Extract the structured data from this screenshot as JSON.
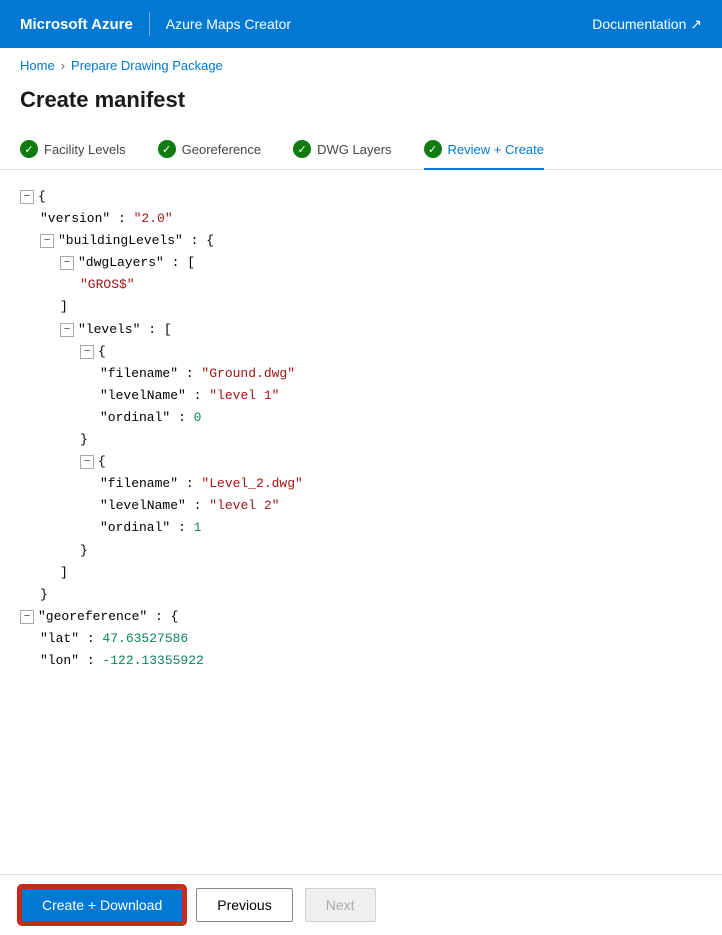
{
  "header": {
    "brand": "Microsoft Azure",
    "product": "Azure Maps Creator",
    "docs_label": "Documentation ↗"
  },
  "breadcrumb": {
    "home": "Home",
    "page": "Prepare Drawing Package"
  },
  "page_title": "Create manifest",
  "tabs": [
    {
      "id": "facility-levels",
      "label": "Facility Levels",
      "checked": true,
      "active": false
    },
    {
      "id": "georeference",
      "label": "Georeference",
      "checked": true,
      "active": false
    },
    {
      "id": "dwg-layers",
      "label": "DWG Layers",
      "checked": true,
      "active": false
    },
    {
      "id": "review-create",
      "label": "Review + Create",
      "checked": false,
      "active": true
    }
  ],
  "json": {
    "version_key": "\"version\"",
    "version_val": "\"2.0\"",
    "buildingLevels_key": "\"buildingLevels\"",
    "dwgLayers_key": "\"dwgLayers\"",
    "gros_val": "\"GROS$\"",
    "levels_key": "\"levels\"",
    "filename_key": "\"filename\"",
    "filename1_val": "\"Ground.dwg\"",
    "levelName_key": "\"levelName\"",
    "levelName1_val": "\"level 1\"",
    "ordinal_key": "\"ordinal\"",
    "ordinal1_val": "0",
    "filename2_val": "\"Level_2.dwg\"",
    "levelName2_val": "\"level 2\"",
    "ordinal2_val": "1",
    "georeference_key": "\"georeference\"",
    "lat_key": "\"lat\"",
    "lat_val": "47.63527586",
    "lon_key": "\"lon\"",
    "lon_val": "-122.13355922"
  },
  "buttons": {
    "create": "Create + Download",
    "previous": "Previous",
    "next": "Next"
  }
}
